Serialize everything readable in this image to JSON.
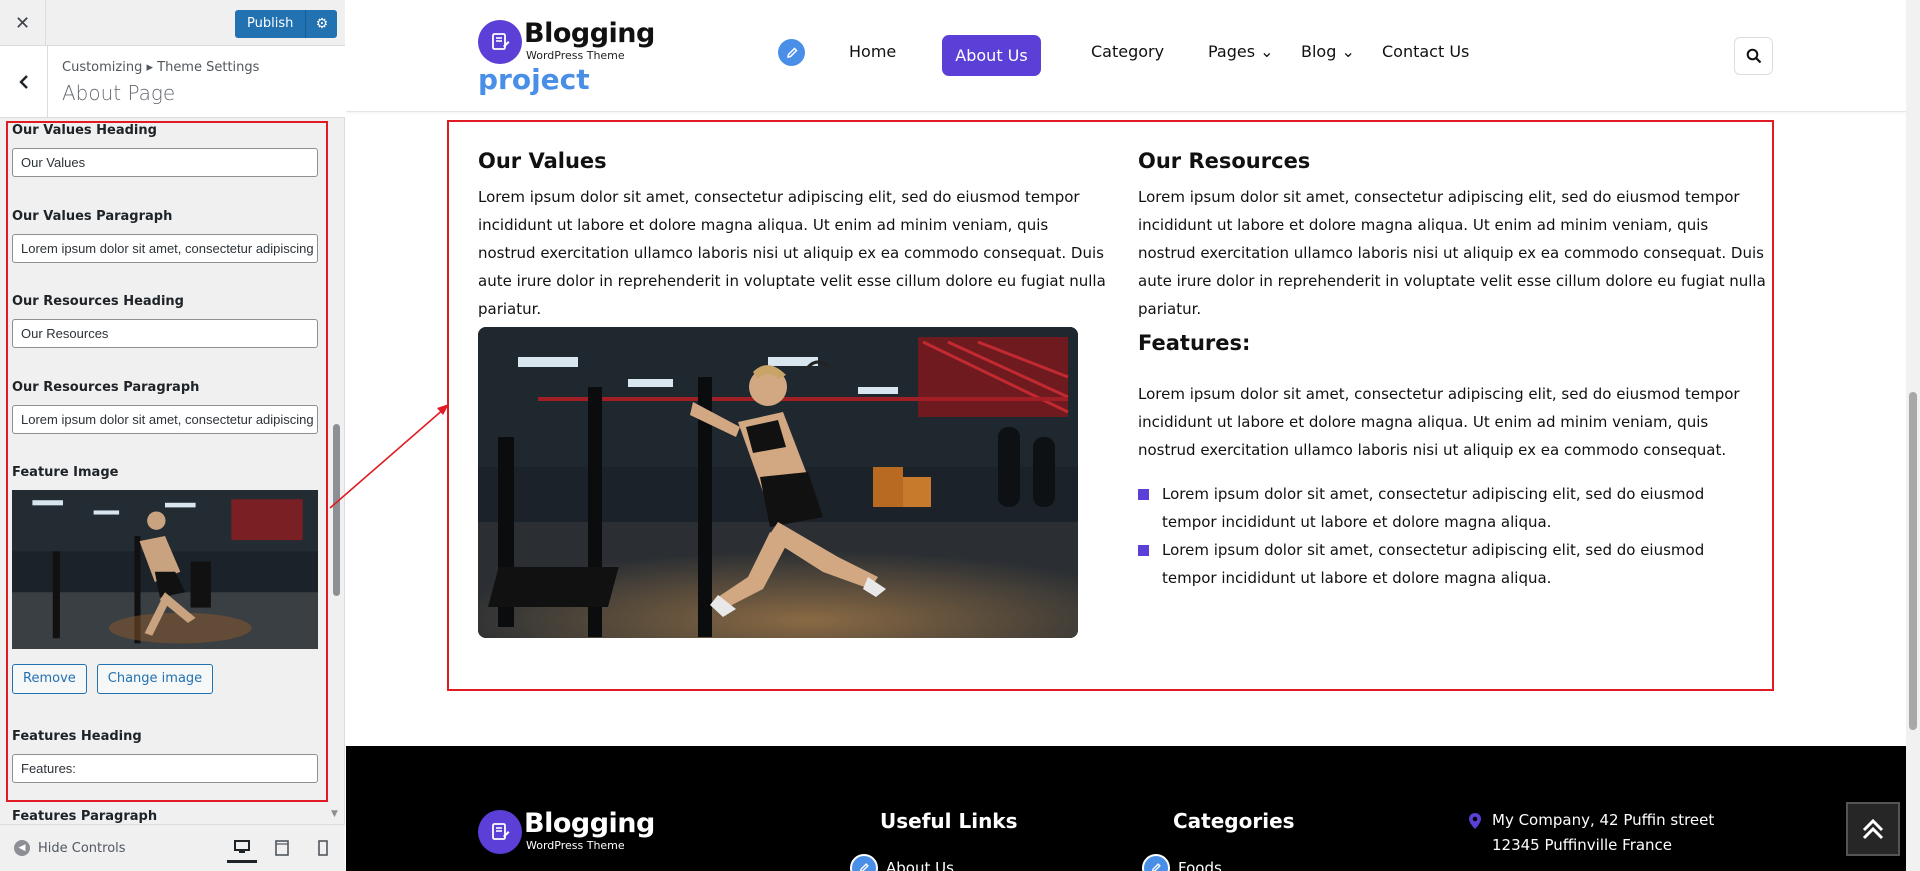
{
  "customizer": {
    "publish_label": "Publish",
    "breadcrumb": "Customizing ▸ Theme Settings",
    "section_title": "About Page",
    "fields": [
      {
        "label": "Our Values Heading",
        "value": "Our Values"
      },
      {
        "label": "Our Values Paragraph",
        "value": "Lorem ipsum dolor sit amet, consectetur adipiscing elit, sed do eiusmod tempor"
      },
      {
        "label": "Our Resources Heading",
        "value": "Our Resources"
      },
      {
        "label": "Our Resources Paragraph",
        "value": "Lorem ipsum dolor sit amet, consectetur adipiscing elit, sed do eiusmod tempor"
      }
    ],
    "feature_image_label": "Feature Image",
    "remove_label": "Remove",
    "change_image_label": "Change image",
    "features_heading_label": "Features Heading",
    "features_heading_value": "Features:",
    "features_paragraph_label": "Features Paragraph",
    "hide_controls_label": "Hide Controls"
  },
  "site": {
    "logo_name": "Blogging",
    "logo_tagline": "WordPress Theme",
    "logo_extra": "project",
    "nav": [
      "Home",
      "About Us",
      "Category",
      "Pages",
      "Blog",
      "Contact Us"
    ],
    "active_nav": "About Us",
    "accent": "#5b3fd6"
  },
  "about": {
    "values_heading": "Our Values",
    "values_paragraph": "Lorem ipsum dolor sit amet, consectetur adipiscing elit, sed do eiusmod tempor incididunt ut labore et dolore magna aliqua. Ut enim ad minim veniam, quis nostrud exercitation ullamco laboris nisi ut aliquip ex ea commodo consequat. Duis aute irure dolor in reprehenderit in voluptate velit esse cillum dolore eu fugiat nulla pariatur.",
    "resources_heading": "Our Resources",
    "resources_paragraph": "Lorem ipsum dolor sit amet, consectetur adipiscing elit, sed do eiusmod tempor incididunt ut labore et dolore magna aliqua. Ut enim ad minim veniam, quis nostrud exercitation ullamco laboris nisi ut aliquip ex ea commodo consequat. Duis aute irure dolor in reprehenderit in voluptate velit esse cillum dolore eu fugiat nulla pariatur.",
    "features_heading": "Features:",
    "features_paragraph": "Lorem ipsum dolor sit amet, consectetur adipiscing elit, sed do eiusmod tempor incididunt ut labore et dolore magna aliqua. Ut enim ad minim veniam, quis nostrud exercitation ullamco laboris nisi ut aliquip ex ea commodo consequat.",
    "features_list": [
      "Lorem ipsum dolor sit amet, consectetur adipiscing elit, sed do eiusmod tempor incididunt ut labore et dolore magna aliqua.",
      "Lorem ipsum dolor sit amet, consectetur adipiscing elit, sed do eiusmod tempor incididunt ut labore et dolore magna aliqua."
    ]
  },
  "footer": {
    "useful_links_heading": "Useful Links",
    "categories_heading": "Categories",
    "useful_link_first": "About Us",
    "category_first": "Foods",
    "address": "My Company, 42 Puffin street 12345 Puffinville France"
  },
  "icons": {
    "close": "close-icon",
    "back": "chevron-left-icon",
    "gear": "gear-icon",
    "search": "search-icon",
    "pen": "pen-icon",
    "location": "location-pin-icon",
    "scroll_top": "double-chevron-up-icon"
  }
}
